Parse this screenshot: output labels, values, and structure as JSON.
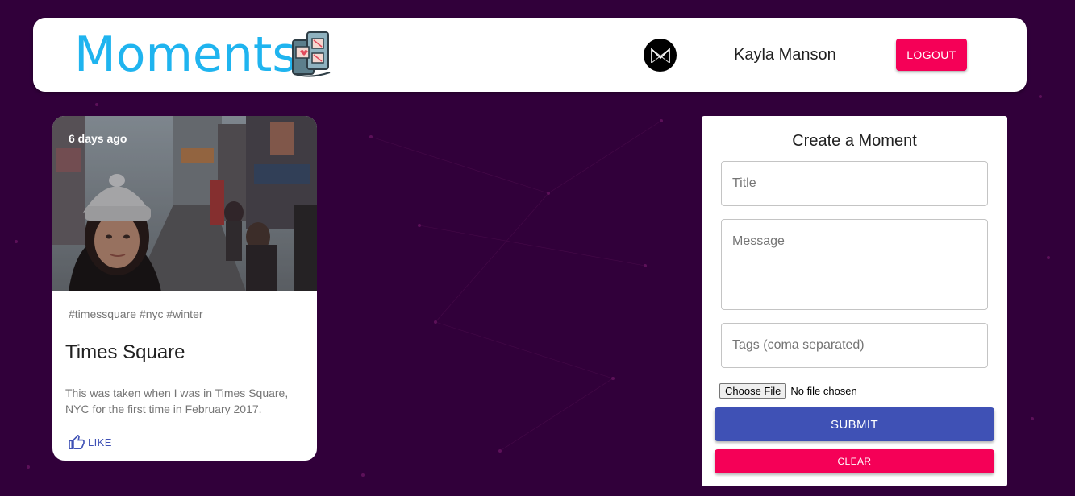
{
  "colors": {
    "background": "#31003a",
    "brand": "#1fb4ef",
    "primary": "#3f51b5",
    "secondary": "#f50057"
  },
  "header": {
    "brand_title": "Moments",
    "brand_icon": "film-strip-heart-icon",
    "avatar_icon": "m-monogram-icon",
    "user_name": "Kayla Manson",
    "logout_label": "LOGOUT"
  },
  "posts": [
    {
      "time": "6 days ago",
      "image": "woman-in-knit-hat-times-square-photo",
      "tags": "#timessquare #nyc #winter",
      "title": "Times Square",
      "message": "This was taken when I was in Times Square, NYC for the first time in February 2017.",
      "like_icon": "thumb-up-icon",
      "like_label": "LIKE"
    }
  ],
  "form": {
    "heading": "Create a Moment",
    "title_placeholder": "Title",
    "message_placeholder": "Message",
    "tags_placeholder": "Tags (coma separated)",
    "file_button": "Choose File",
    "file_status": "No file chosen",
    "submit_label": "SUBMIT",
    "clear_label": "CLEAR"
  }
}
